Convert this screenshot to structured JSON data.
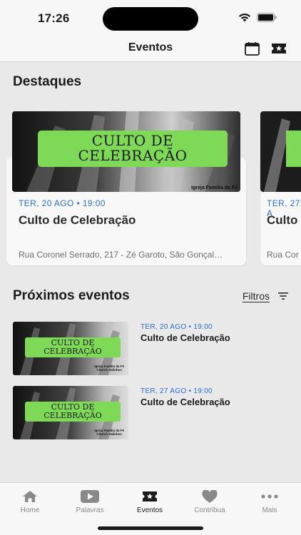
{
  "status_bar": {
    "time": "17:26"
  },
  "nav": {
    "title": "Eventos",
    "calendar_icon": "calendar-icon",
    "ticket_icon": "ticket-icon"
  },
  "featured": {
    "title": "Destaques",
    "cards": [
      {
        "date": "TER, 20 AGO • 19:00",
        "title": "Culto de Celebração",
        "address": "Rua Coronel Serrado, 217 - Zé Garoto, São Gonçal…",
        "banner_line1": "CULTO DE",
        "banner_line2": "CELEBRAÇÃO",
        "tag": "Igreja Família da Fé"
      },
      {
        "date": "TER, 27 A",
        "title": "Culto",
        "address": "Rua Cor"
      }
    ]
  },
  "upcoming": {
    "title": "Próximos eventos",
    "filter_label": "Filtros",
    "items": [
      {
        "date": "TER, 20 AGO • 19:00",
        "title": "Culto de Celebração",
        "banner_line1": "CULTO DE",
        "banner_line2": "CELEBRAÇÃO",
        "tag_line1": "Igreja Família da Fé",
        "tag_line2": "Church Valinhos"
      },
      {
        "date": "TER, 27 AGO • 19:00",
        "title": "Culto de Celebração",
        "banner_line1": "CULTO DE",
        "banner_line2": "CELEBRAÇÃO",
        "tag_line1": "Igreja Família da Fé",
        "tag_line2": "Church Valinhos"
      }
    ]
  },
  "tabs": [
    {
      "label": "Home",
      "icon": "home-icon",
      "active": false
    },
    {
      "label": "Palavras",
      "icon": "play-icon",
      "active": false
    },
    {
      "label": "Eventos",
      "icon": "ticket-icon",
      "active": true
    },
    {
      "label": "Contribua",
      "icon": "heart-icon",
      "active": false
    },
    {
      "label": "Mais",
      "icon": "more-icon",
      "active": false
    }
  ],
  "colors": {
    "accent_date": "#2a6fd6",
    "banner_green": "#7ed957",
    "background": "#e9e9e9"
  }
}
